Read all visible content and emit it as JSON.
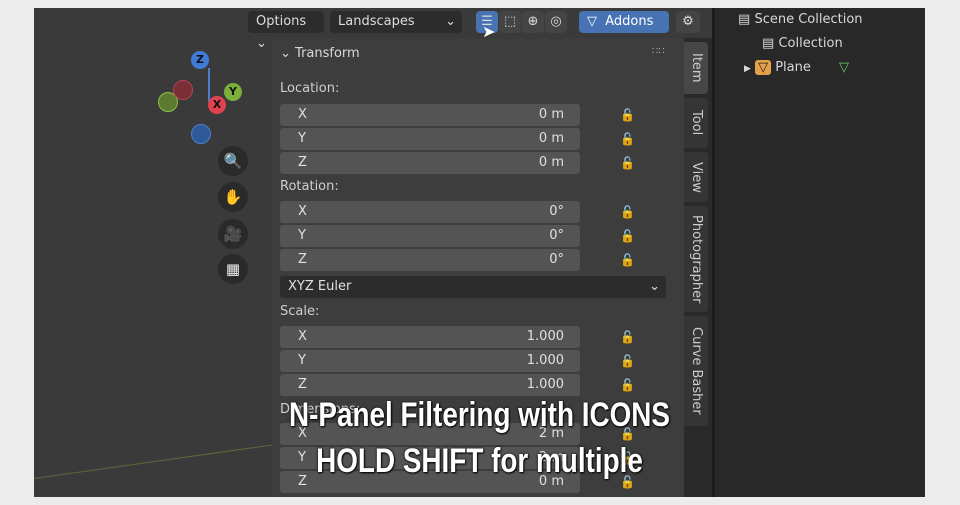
{
  "header": {
    "options": "Options",
    "workspace": "Landscapes",
    "filter_button": "Addons",
    "icons": [
      "list-filter-icon",
      "selection-box-icon",
      "add-circle-icon",
      "blender-icon",
      "funnel-icon",
      "gear-icon"
    ]
  },
  "gizmo": {
    "axes": [
      "Z",
      "Y",
      "X"
    ],
    "tools": [
      "zoom-icon",
      "hand-pan-icon",
      "camera-icon",
      "grid-ortho-icon"
    ]
  },
  "panel": {
    "section": "Transform",
    "location": {
      "label": "Location:",
      "rows": [
        {
          "axis": "X",
          "value": "0 m"
        },
        {
          "axis": "Y",
          "value": "0 m"
        },
        {
          "axis": "Z",
          "value": "0 m"
        }
      ]
    },
    "rotation": {
      "label": "Rotation:",
      "rows": [
        {
          "axis": "X",
          "value": "0°"
        },
        {
          "axis": "Y",
          "value": "0°"
        },
        {
          "axis": "Z",
          "value": "0°"
        }
      ],
      "mode": "XYZ Euler"
    },
    "scale": {
      "label": "Scale:",
      "rows": [
        {
          "axis": "X",
          "value": "1.000"
        },
        {
          "axis": "Y",
          "value": "1.000"
        },
        {
          "axis": "Z",
          "value": "1.000"
        }
      ]
    },
    "dimensions": {
      "label": "Dimensions:",
      "rows": [
        {
          "axis": "X",
          "value": "2 m"
        },
        {
          "axis": "Y",
          "value": "2 m"
        },
        {
          "axis": "Z",
          "value": "0 m"
        }
      ]
    }
  },
  "tabs": [
    "Item",
    "Tool",
    "View",
    "Photographer",
    "Curve Basher"
  ],
  "outliner": {
    "scene": "Scene Collection",
    "collection": "Collection",
    "object": "Plane"
  },
  "caption": {
    "line1": "N-Panel Filtering with ICONS",
    "line2": "HOLD SHIFT for multiple"
  }
}
